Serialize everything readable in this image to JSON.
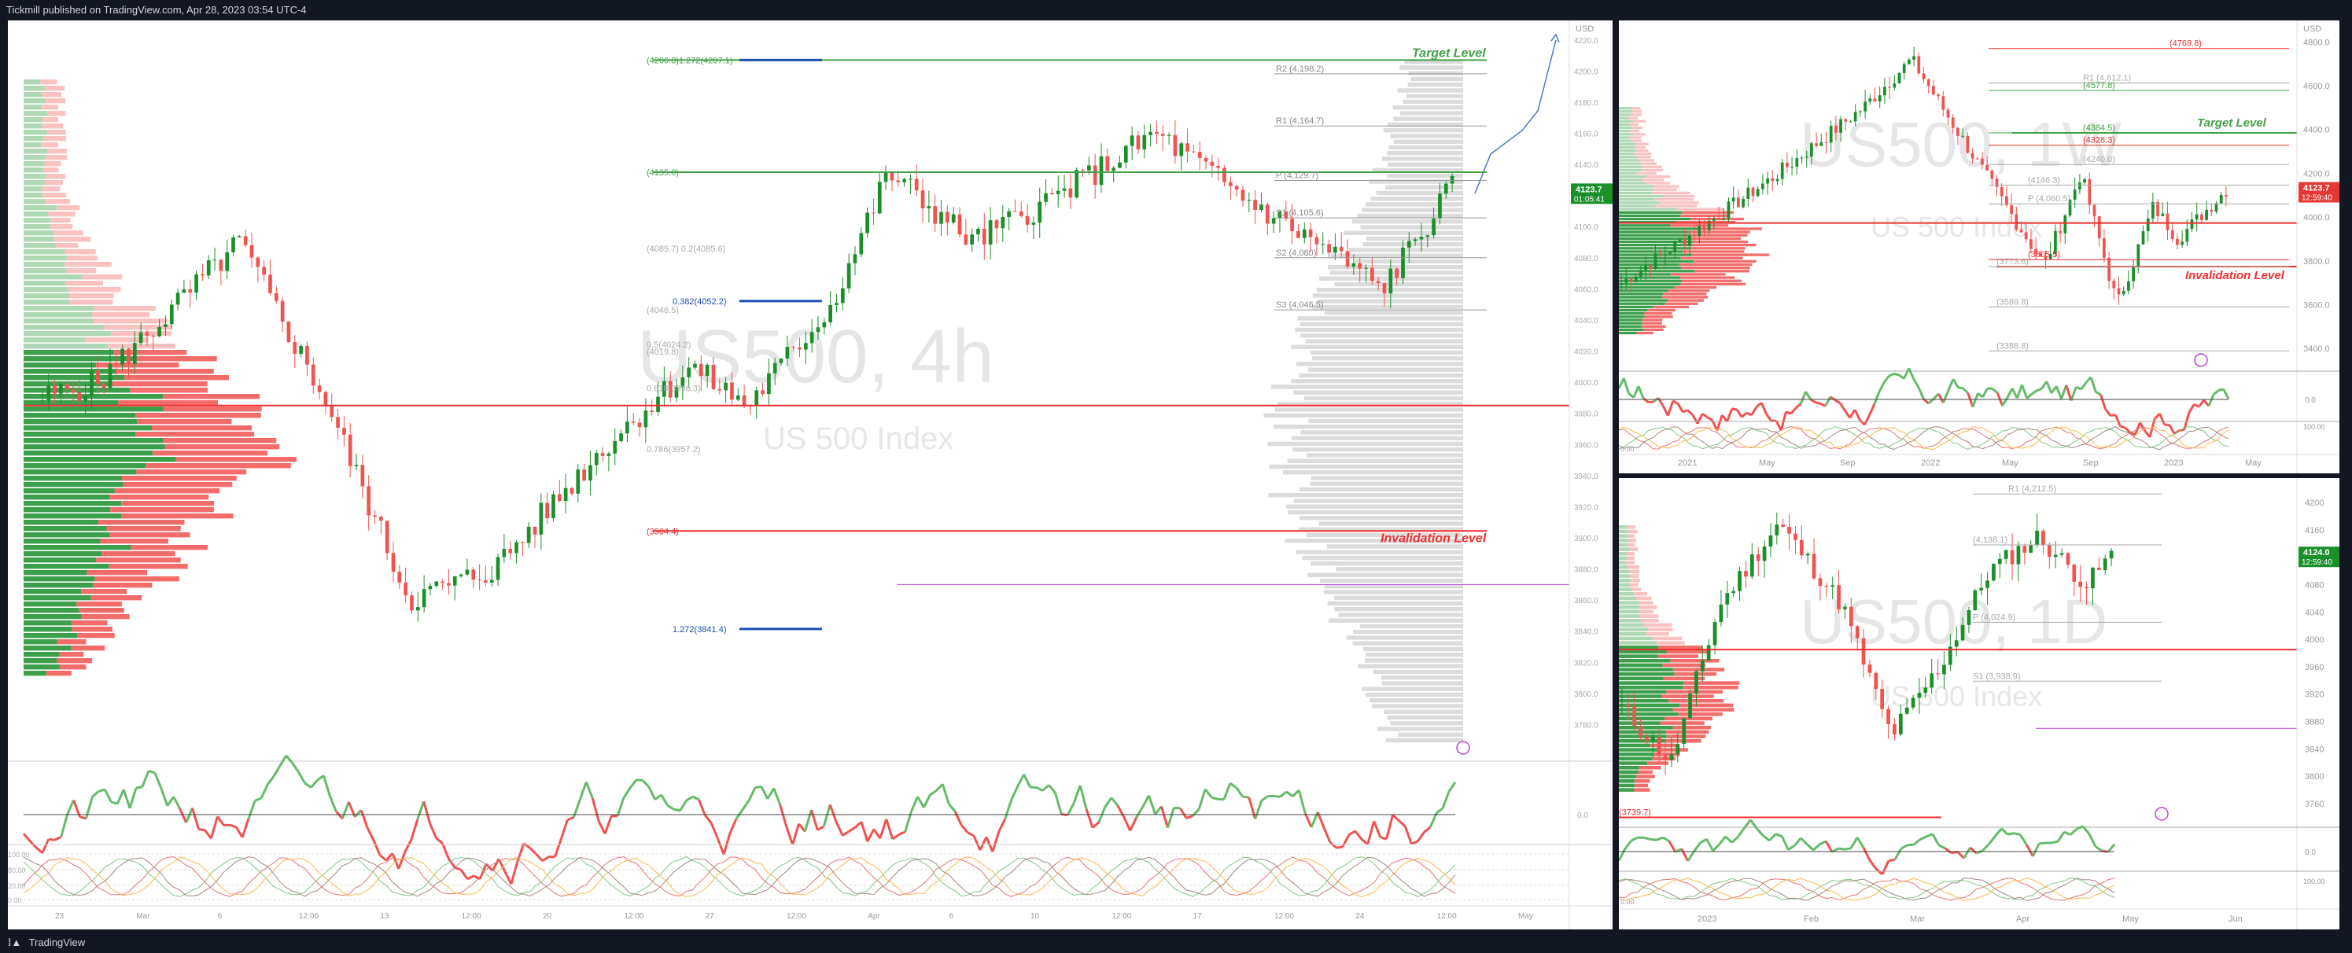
{
  "header": {
    "publish_text": "Tickmill published on TradingView.com, Apr 28, 2023 03:54 UTC-4"
  },
  "footer": {
    "brand": "TradingView",
    "logo_icon": "tradingview-logo-icon"
  },
  "colors": {
    "up": "#1a8f2a",
    "down": "#f05350",
    "target": "#43a047",
    "invalid": "#ef2f2f",
    "fib_blue": "#1e4fb0",
    "magenta": "#c040e0",
    "grid": "#eeeeee",
    "watermark": "#e6e6e6"
  },
  "main_chart": {
    "watermark_symbol": "US500, 4h",
    "watermark_name": "US 500 Index",
    "target_label": "Target Level",
    "invalidation_label": "Invalidation Level",
    "price_badge": "4123.7",
    "price_badge_sub": "01:05:41",
    "axis_currency": "USD",
    "price_ticks": [
      "4220.0",
      "4200.0",
      "4180.0",
      "4160.0",
      "4140.0",
      "4120.0",
      "4100.0",
      "4080.0",
      "4060.0",
      "4040.0",
      "4020.0",
      "4000.0",
      "3980.0",
      "3960.0",
      "3940.0",
      "3920.0",
      "3900.0",
      "3880.0",
      "3860.0",
      "3840.0",
      "3820.0",
      "3800.0",
      "3780.0"
    ],
    "time_labels": [
      "23",
      "Mar",
      "6",
      "12:00",
      "13",
      "12:00",
      "20",
      "12:00",
      "27",
      "12:00",
      "Apr",
      "6",
      "10",
      "12:00",
      "17",
      "12:00",
      "24",
      "12:00",
      "May"
    ],
    "rsi_ticks": [
      "0.0"
    ],
    "stoch_ticks": [
      "100.00",
      "80.00",
      "20.00",
      "0.00"
    ],
    "fib_labels": [
      {
        "text": "(4206.8)1.272(4207.1)",
        "price": 4207
      },
      {
        "text": "(4135.0)",
        "price": 4135
      },
      {
        "text": "(4085.7) 0.2(4085.6)",
        "price": 4086
      },
      {
        "text": "0.382(4052.2)",
        "price": 4052.2
      },
      {
        "text": "(4046.5)",
        "price": 4046.5
      },
      {
        "text": "(4019.8)",
        "price": 4019.8
      },
      {
        "text": "0.5(4024.2)",
        "price": 4024.2
      },
      {
        "text": "0.618(3996.3)",
        "price": 3996.3
      },
      {
        "text": "0.786(3957.2)",
        "price": 3957.2
      },
      {
        "text": "(3904.4)",
        "price": 3904.4
      },
      {
        "text": "1.272(3841.4)",
        "price": 3841.4
      }
    ],
    "pivot_labels": [
      {
        "text": "R2 (4,198.2)",
        "price": 4198.2
      },
      {
        "text": "R1 (4,164.7)",
        "price": 4164.7
      },
      {
        "text": "P (4,129.7)",
        "price": 4129.7
      },
      {
        "text": "S1 (4,105.6)",
        "price": 4105.6
      },
      {
        "text": "S2 (4,080)",
        "price": 4080
      },
      {
        "text": "S3 (4,046.5)",
        "price": 4046.5
      }
    ]
  },
  "weekly_chart": {
    "watermark_symbol": "US500, 1W",
    "watermark_name": "US 500 Index",
    "target_label": "Target Level",
    "invalidation_label": "Invalidation Level",
    "price_badge": "4123.7",
    "price_badge_sub": "12:59:40",
    "axis_currency": "USD",
    "price_ticks": [
      "4800.0",
      "4600.0",
      "4400.0",
      "4200.0",
      "4000.0",
      "3800.0",
      "3600.0",
      "3400.0"
    ],
    "time_labels": [
      "2021",
      "May",
      "Sep",
      "2022",
      "May",
      "Sep",
      "2023",
      "May"
    ],
    "rsi_ticks": [
      "0.0"
    ],
    "stoch_ticks": [
      "100.00",
      "0.00"
    ],
    "line_labels": [
      {
        "text": "(4769.8)",
        "price": 4769.8
      },
      {
        "text": "R1 (4,612.1)",
        "price": 4612.1
      },
      {
        "text": "(4577.8)",
        "price": 4577.8
      },
      {
        "text": "(4384.5)",
        "price": 4384.5
      },
      {
        "text": "(4328.3)",
        "price": 4328.3
      },
      {
        "text": "(4240.0)",
        "price": 4240
      },
      {
        "text": "(4146.3)",
        "price": 4146.3
      },
      {
        "text": "P (4,060.5)",
        "price": 4060.5
      },
      {
        "text": "(3805.5)",
        "price": 3805.5
      },
      {
        "text": "(3773.6)",
        "price": 3773.6
      },
      {
        "text": "(3589.8)",
        "price": 3589.8
      },
      {
        "text": "(3388.8)",
        "price": 3388.8
      }
    ]
  },
  "daily_chart": {
    "watermark_symbol": "US500, 1D",
    "watermark_name": "US 500 Index",
    "price_badge": "4124.0",
    "price_badge_sub": "12:59:40",
    "price_ticks": [
      "4200",
      "4160",
      "4120",
      "4080",
      "4040",
      "4000",
      "3960",
      "3920",
      "3880",
      "3840",
      "3800",
      "3760"
    ],
    "time_labels": [
      "2023",
      "Feb",
      "Mar",
      "Apr",
      "May",
      "Jun"
    ],
    "rsi_ticks": [
      "0.0"
    ],
    "stoch_ticks": [
      "100.00",
      "0.00"
    ],
    "line_labels": [
      {
        "text": "R1 (4,212.5)",
        "price": 4212.5
      },
      {
        "text": "(4,138.1)",
        "price": 4138.1
      },
      {
        "text": "P (4,024.9)",
        "price": 4024.9
      },
      {
        "text": "S1 (3,938.9)",
        "price": 3938.9
      },
      {
        "text": "(3739.7)",
        "price": 3739.7
      }
    ]
  },
  "chart_data": [
    {
      "type": "candlestick",
      "title": "US500, 4h",
      "ylabel": "USD",
      "ylim": [
        3760,
        4230
      ],
      "last_close": 4123.7,
      "target_level": 4207.1,
      "invalidation_level": 3904.4
    },
    {
      "type": "candlestick",
      "title": "US500, 1W",
      "ylabel": "USD",
      "ylim": [
        3300,
        4880
      ],
      "last_close": 4123.7,
      "target_level": 4384.5,
      "invalidation_level": 3773.6
    },
    {
      "type": "candlestick",
      "title": "US500, 1D",
      "ylabel": "USD",
      "ylim": [
        3730,
        4230
      ],
      "last_close": 4124.0
    }
  ]
}
